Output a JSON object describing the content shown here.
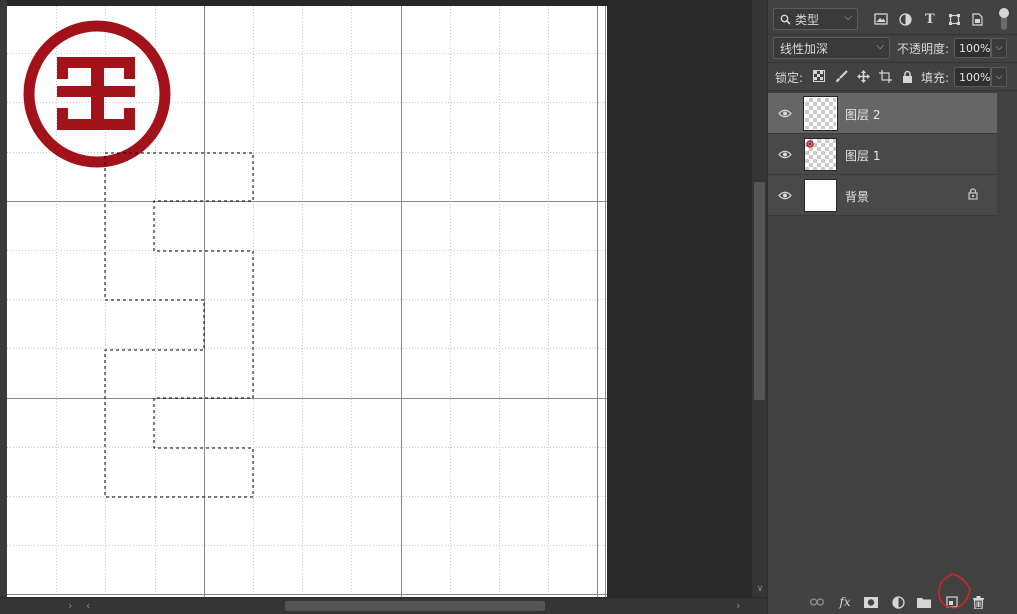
{
  "panel": {
    "filter_kind_label": "类型",
    "blend_mode": "线性加深",
    "opacity_label": "不透明度:",
    "opacity_value": "100%",
    "lock_label": "锁定:",
    "fill_label": "填充:",
    "fill_value": "100%"
  },
  "layers": [
    {
      "name": "图层 2",
      "selected": true,
      "visible": true,
      "thumbnail": "transparent"
    },
    {
      "name": "图层 1",
      "selected": false,
      "visible": true,
      "thumbnail": "transparent-with-logo"
    },
    {
      "name": "背景",
      "selected": false,
      "visible": true,
      "thumbnail": "white",
      "locked": true
    }
  ],
  "bottom_bar_icons": [
    "link-layers-icon",
    "fx-icon",
    "layer-mask-icon",
    "adjustment-layer-icon",
    "group-folder-icon",
    "new-layer-icon",
    "delete-icon"
  ],
  "colors": {
    "logo_red": "#a3121a",
    "annotation_red": "#e02020",
    "panel_bg": "#424242",
    "selected_layer": "#666666"
  }
}
